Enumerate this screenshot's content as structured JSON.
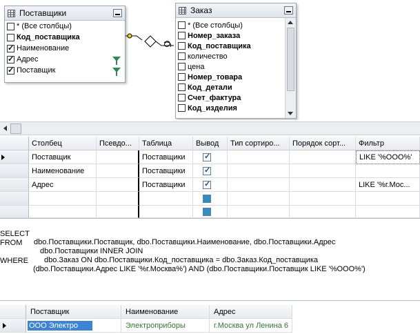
{
  "diagram": {
    "tables": [
      {
        "title": "Поставщики",
        "columns": [
          {
            "label": "* (Все столбцы)",
            "checked": false,
            "bold": false,
            "filter": false
          },
          {
            "label": "Код_поставщика",
            "checked": false,
            "bold": true,
            "filter": false
          },
          {
            "label": "Наименование",
            "checked": true,
            "bold": false,
            "filter": false
          },
          {
            "label": "Адрес",
            "checked": true,
            "bold": false,
            "filter": true
          },
          {
            "label": "Поставщик",
            "checked": true,
            "bold": false,
            "filter": true
          }
        ]
      },
      {
        "title": "Заказ",
        "columns": [
          {
            "label": "* (Все столбцы)",
            "checked": false,
            "bold": false
          },
          {
            "label": "Номер_заказа",
            "checked": false,
            "bold": true
          },
          {
            "label": "Код_поставщика",
            "checked": false,
            "bold": true
          },
          {
            "label": "количество",
            "checked": false,
            "bold": false
          },
          {
            "label": "цена",
            "checked": false,
            "bold": false
          },
          {
            "label": "Номер_товара",
            "checked": false,
            "bold": true
          },
          {
            "label": "Код_детали",
            "checked": false,
            "bold": true
          },
          {
            "label": "Счет_фактура",
            "checked": false,
            "bold": true
          },
          {
            "label": "Код_изделия",
            "checked": false,
            "bold": true
          }
        ]
      }
    ]
  },
  "grid": {
    "headers": [
      "Столбец",
      "Псевдо...",
      "Таблица",
      "Вывод",
      "Тип сортиро...",
      "Порядок сорт...",
      "Фильтр"
    ],
    "rows": [
      {
        "column": "Поставщик",
        "alias": "",
        "table": "Поставщики",
        "output": "checked",
        "filter": "LIKE '%ООО%'"
      },
      {
        "column": "Наименование",
        "alias": "",
        "table": "Поставщики",
        "output": "checked",
        "filter": ""
      },
      {
        "column": "Адрес",
        "alias": "",
        "table": "Поставщики",
        "output": "checked",
        "filter": "LIKE '%г.Мос..."
      },
      {
        "column": "",
        "alias": "",
        "table": "",
        "output": "square",
        "filter": ""
      },
      {
        "column": "",
        "alias": "",
        "table": "",
        "output": "square",
        "filter": ""
      }
    ]
  },
  "sql": {
    "lines": [
      {
        "keyword": "SELECT",
        "text": "dbo.Поставщики.Поставщик, dbo.Поставщики.Наименование, dbo.Поставщики.Адрес"
      },
      {
        "keyword": "FROM",
        "text": "dbo.Поставщики INNER JOIN"
      },
      {
        "keyword": "",
        "text": "dbo.Заказ ON dbo.Поставщики.Код_поставщика = dbo.Заказ.Код_поставщика"
      },
      {
        "keyword": "WHERE",
        "text": "(dbo.Поставщики.Адрес LIKE '%г.Москва%') AND (dbo.Поставщики.Поставщик LIKE '%ООО%')"
      }
    ]
  },
  "results": {
    "headers": [
      "Поставщик",
      "Наименование",
      "Адрес"
    ],
    "rows": [
      {
        "supplier": "ООО Электро",
        "name": "Электроприборы",
        "address": "г.Москва ул Ленина 6"
      }
    ]
  },
  "colors": {
    "filter_icon": "#2e8b57",
    "selection": "#3b84d8",
    "result_text": "#2f7a2f"
  }
}
